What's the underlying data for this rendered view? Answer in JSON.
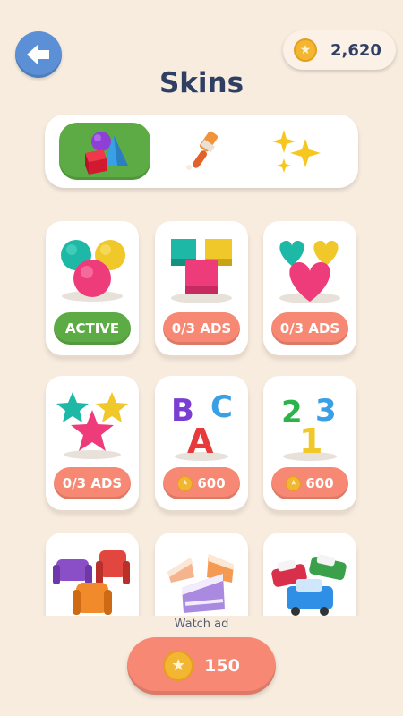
{
  "header": {
    "title": "Skins",
    "coins": "2,620"
  },
  "tabs": [
    {
      "name": "shapes",
      "icon": "shapes-icon",
      "active": true
    },
    {
      "name": "brush",
      "icon": "paint-brush-icon",
      "active": false
    },
    {
      "name": "effects",
      "icon": "sparkles-icon",
      "active": false
    }
  ],
  "skins": [
    {
      "icon": "balls-skin-icon",
      "button": "ACTIVE",
      "status": "active"
    },
    {
      "icon": "cubes-skin-icon",
      "button": "0/3 ADS",
      "status": "ads"
    },
    {
      "icon": "hearts-skin-icon",
      "button": "0/3 ADS",
      "status": "ads"
    },
    {
      "icon": "stars-skin-icon",
      "button": "0/3 ADS",
      "status": "ads"
    },
    {
      "icon": "letters-skin-icon",
      "button": "600",
      "status": "coins",
      "letters": [
        "B",
        "C",
        "A"
      ]
    },
    {
      "icon": "numbers-skin-icon",
      "button": "600",
      "status": "coins",
      "numbers": [
        "2",
        "3",
        "1"
      ]
    },
    {
      "icon": "furniture-skin-icon",
      "button": "",
      "status": "hidden"
    },
    {
      "icon": "cakes-skin-icon",
      "button": "",
      "status": "hidden"
    },
    {
      "icon": "cars-skin-icon",
      "button": "",
      "status": "hidden"
    }
  ],
  "footer": {
    "watch_label": "Watch ad",
    "reward": "150"
  },
  "colors": {
    "background": "#f8ecdf",
    "accent_green": "#5dab45",
    "accent_salmon": "#f78873",
    "back_blue": "#5b8fd6",
    "title": "#2f3f63"
  }
}
